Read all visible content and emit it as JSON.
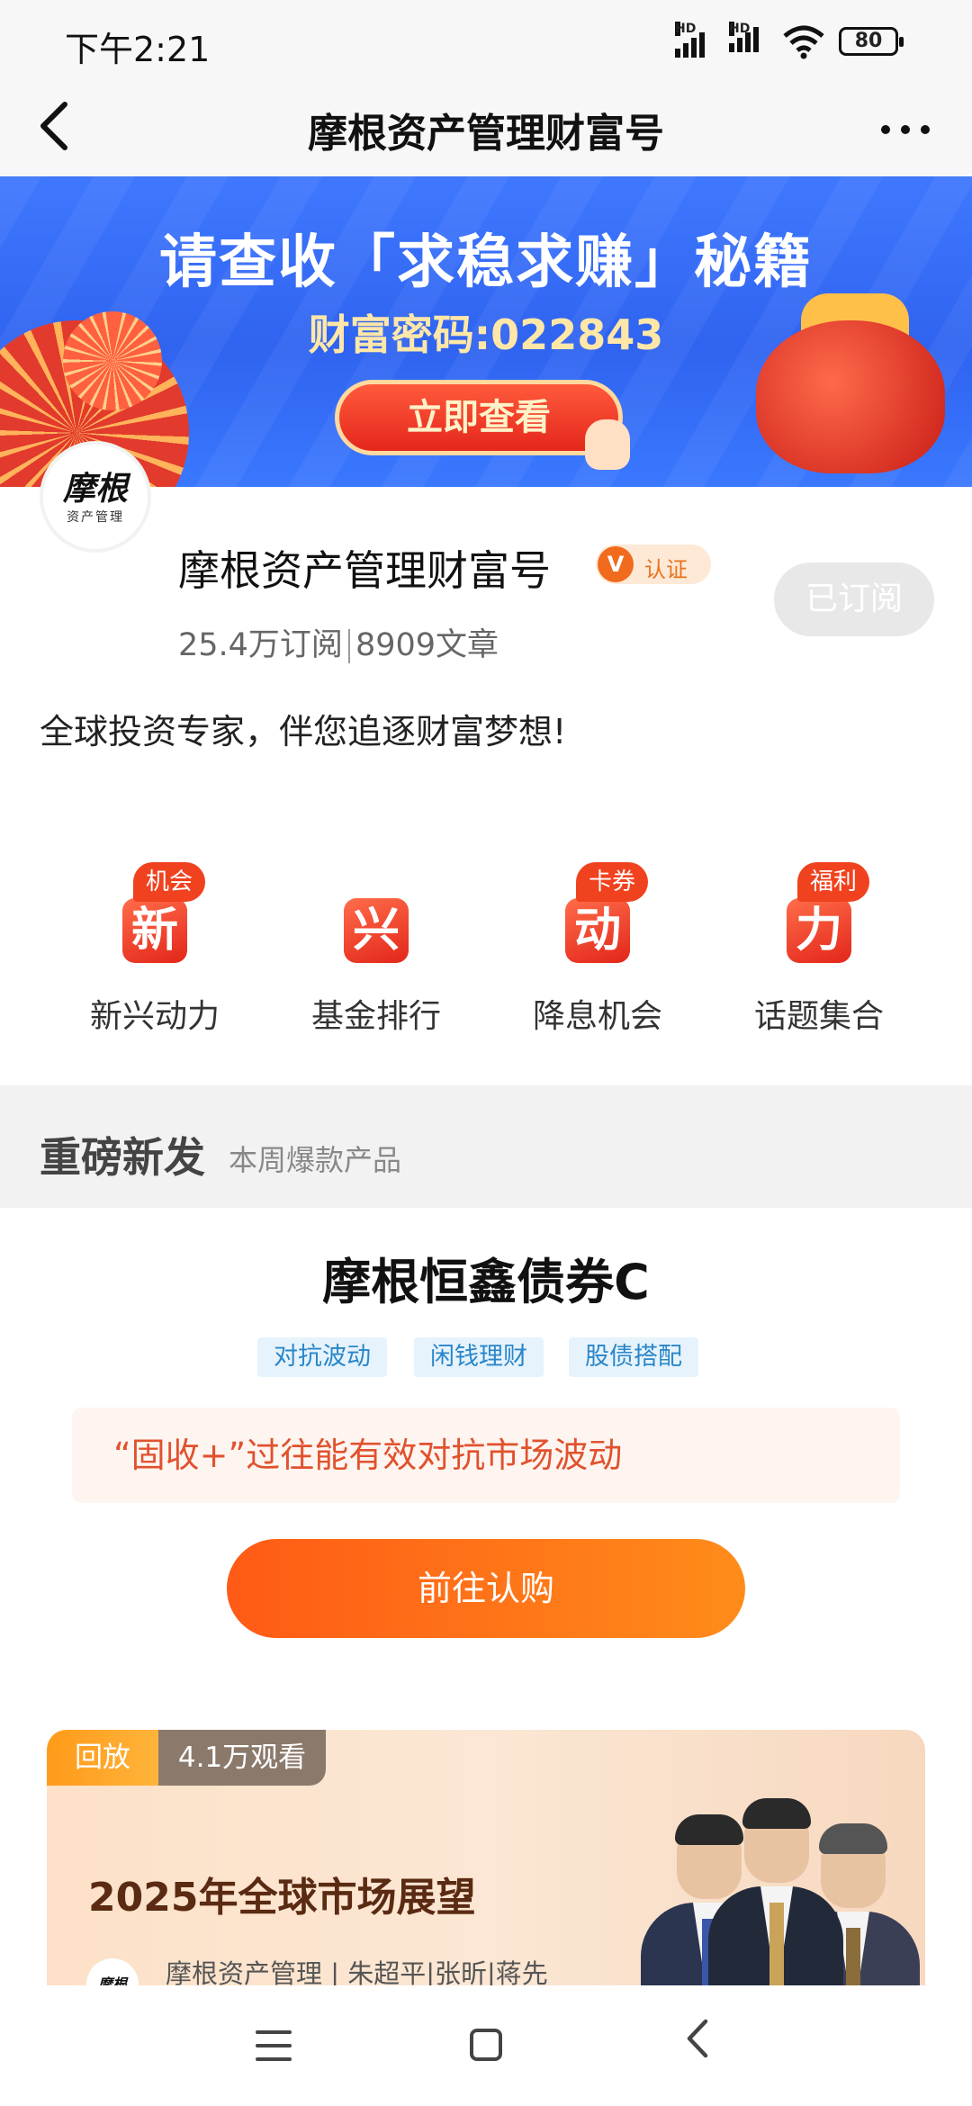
{
  "status_bar": {
    "time": "下午2:21",
    "signal1_label": "HD",
    "signal2_label": "HD",
    "battery": "80"
  },
  "nav": {
    "title": "摩根资产管理财富号",
    "back_icon": "chevron-left-icon",
    "more_icon": "more-horizontal-icon"
  },
  "banner": {
    "headline": "请查收「求稳求赚」秘籍",
    "code": "财富密码:022843",
    "cta": "立即查看"
  },
  "profile": {
    "logo_text": "摩根",
    "logo_sub": "资产管理",
    "name": "摩根资产管理财富号",
    "verify_badge": "V",
    "verify_label": "认证",
    "subscribe_button": "已订阅",
    "subscribers": "25.4万订阅",
    "articles": "8909文章",
    "description": "全球投资专家，伴您追逐财富梦想!"
  },
  "entries": [
    {
      "icon_char": "新",
      "tag": "机会",
      "label": "新兴动力"
    },
    {
      "icon_char": "兴",
      "tag": "",
      "label": "基金排行"
    },
    {
      "icon_char": "动",
      "tag": "卡券",
      "label": "降息机会"
    },
    {
      "icon_char": "力",
      "tag": "福利",
      "label": "话题集合"
    }
  ],
  "section": {
    "title": "重磅新发",
    "subtitle": "本周爆款产品"
  },
  "product": {
    "name": "摩根恒鑫债券C",
    "chips": [
      "对抗波动",
      "闲钱理财",
      "股债搭配"
    ],
    "highlight": "“固收+”过往能有效对抗市场波动",
    "buy_button": "前往认购"
  },
  "live_card": {
    "replay_label": "回放",
    "views": "4.1万观看",
    "title": "2025年全球市场展望",
    "avatar_text": "摩根",
    "author": "摩根资产管理 | 朱超平|张昕|蒋先"
  },
  "colors": {
    "accent": "#ff6a1a",
    "banner_blue": "#3a6ef5",
    "chip_blue": "#2a86c9"
  }
}
